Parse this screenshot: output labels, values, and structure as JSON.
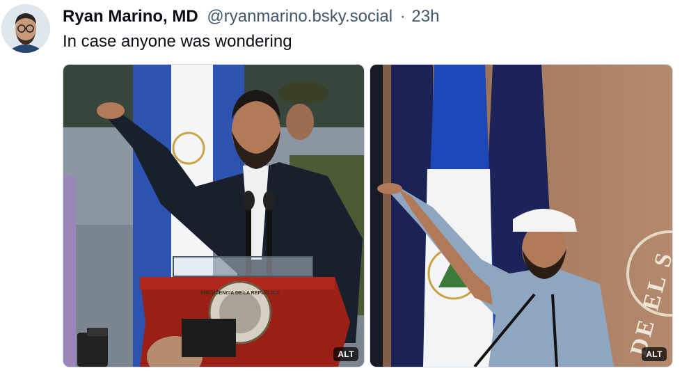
{
  "post": {
    "author": {
      "display_name": "Ryan Marino, MD",
      "handle": "@ryanmarino.bsky.social"
    },
    "separator": "·",
    "time": "23h",
    "text": "In case anyone was wondering",
    "images": [
      {
        "alt_badge": "ALT",
        "podium_seal": "PRESIDENCIA DE LA REPÚBLICA"
      },
      {
        "alt_badge": "ALT",
        "wall_text": "DE EL S"
      }
    ]
  }
}
